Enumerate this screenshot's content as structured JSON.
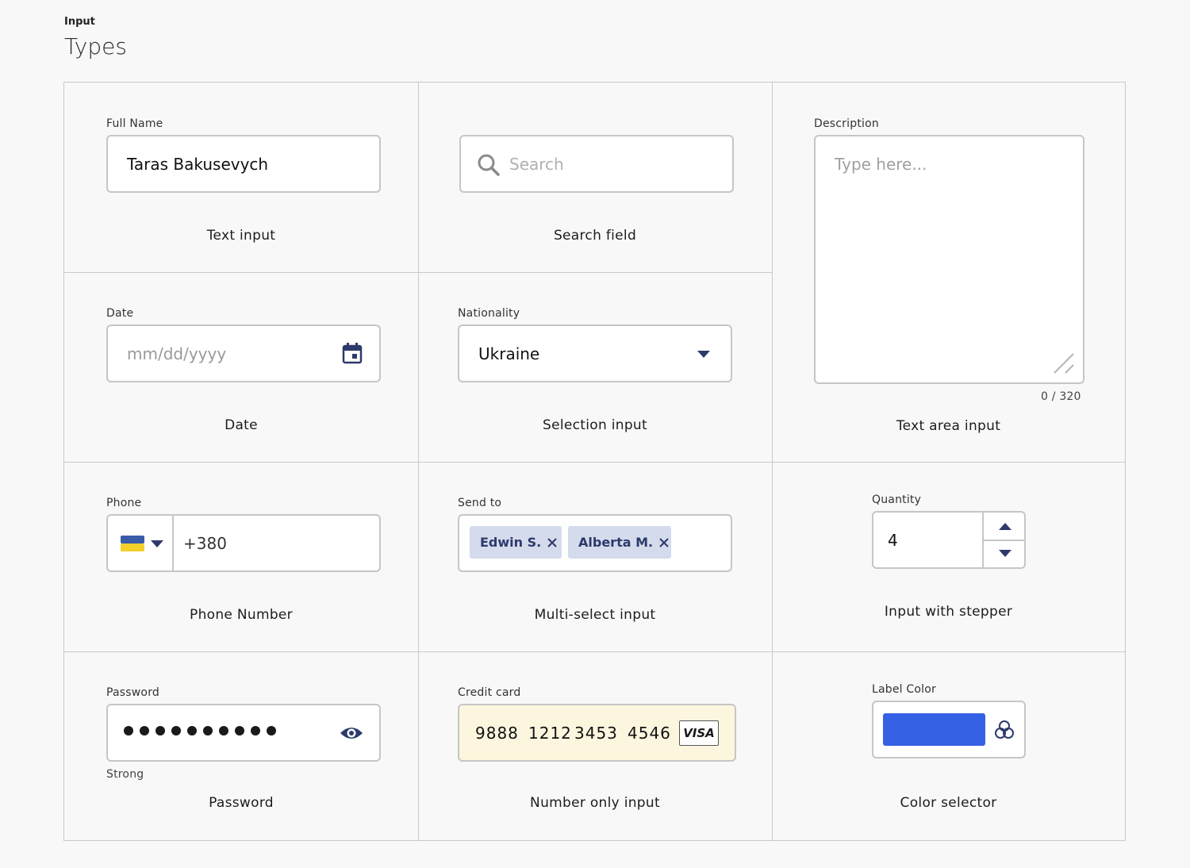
{
  "header": {
    "kicker": "Input",
    "title": "Types"
  },
  "text_input": {
    "label": "Full Name",
    "value": "Taras Bakusevych",
    "caption": "Text input"
  },
  "search_field": {
    "placeholder": "Search",
    "caption": "Search field",
    "icon": "search-icon"
  },
  "textarea": {
    "label": "Description",
    "placeholder": "Type here...",
    "counter": "0 / 320",
    "caption": "Text area input"
  },
  "date": {
    "label": "Date",
    "placeholder": "mm/dd/yyyy",
    "caption": "Date",
    "icon": "calendar-icon"
  },
  "selection": {
    "label": "Nationality",
    "value": "Ukraine",
    "caption": "Selection input"
  },
  "phone": {
    "label": "Phone",
    "value": "+380",
    "caption": "Phone Number",
    "flag_colors": [
      "#3a5ba9",
      "#f5cf2a"
    ]
  },
  "multi_select": {
    "label": "Send to",
    "chips": [
      "Edwin S.",
      "Alberta M."
    ],
    "caption": "Multi-select input"
  },
  "stepper": {
    "label": "Quantity",
    "value": "4",
    "caption": "Input with stepper"
  },
  "password": {
    "label": "Password",
    "strength": "Strong",
    "caption": "Password",
    "icon": "eye-icon",
    "masked_length": 10
  },
  "credit_card": {
    "label": "Credit card",
    "groups": [
      "9888",
      "1212",
      "3453",
      "4546"
    ],
    "brand": "VISA",
    "caption": "Number only input",
    "background": "#fdf6de"
  },
  "color_selector": {
    "label": "Label Color",
    "swatch": "#3561e4",
    "caption": "Color selector",
    "icon": "palette-icon"
  },
  "colors": {
    "accent": "#2d3a6b",
    "border": "#c6c6c6",
    "chip_bg": "#d4dbec"
  }
}
